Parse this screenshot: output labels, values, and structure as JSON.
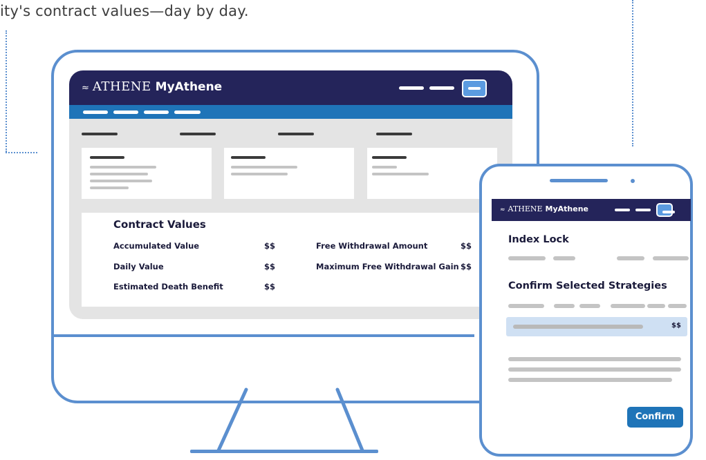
{
  "caption": "ity's contract values—day by day.",
  "desktop": {
    "brand": {
      "logo_mark": "≈",
      "company": "ATHENE",
      "product": "MyAthene"
    },
    "contract_values": {
      "title": "Contract Values",
      "left_rows": [
        {
          "label": "Accumulated Value",
          "value": "$$"
        },
        {
          "label": "Daily Value",
          "value": "$$"
        },
        {
          "label": "Estimated Death Benefit",
          "value": "$$"
        }
      ],
      "right_rows": [
        {
          "label": "Free Withdrawal Amount",
          "value": "$$"
        },
        {
          "label": "Maximum Free Withdrawal Gain",
          "value": "$$"
        }
      ]
    }
  },
  "mobile": {
    "brand": {
      "logo_mark": "≈",
      "company": "ATHENE",
      "product": "MyAthene"
    },
    "index_lock_title": "Index Lock",
    "confirm_strategies_title": "Confirm Selected Strategies",
    "highlight_value": "$$",
    "confirm_label": "Confirm"
  },
  "colors": {
    "navy": "#24245a",
    "blue": "#1f74b8",
    "outline": "#5b8fcf",
    "highlight": "#cfe0f3"
  }
}
